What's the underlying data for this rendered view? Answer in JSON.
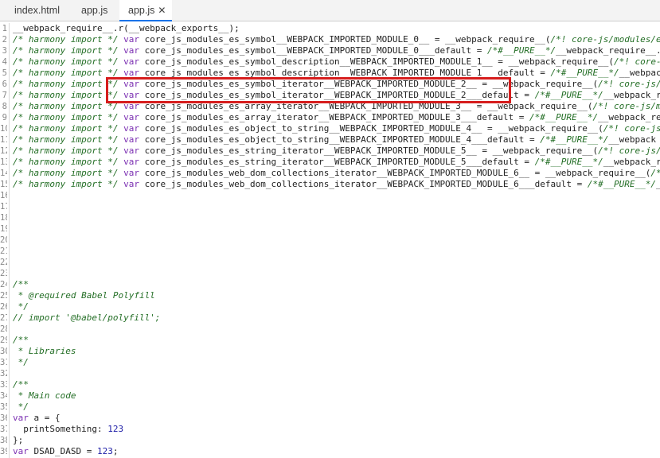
{
  "tabs": [
    {
      "label": "index.html",
      "active": false
    },
    {
      "label": "app.js",
      "active": false
    },
    {
      "label": "app.js",
      "active": true,
      "close": "✕"
    }
  ],
  "colors": {
    "comment": "#236e25",
    "keyword": "#7b2fb2",
    "number": "#1c1ca6",
    "highlight": "#d61d1d",
    "active_tab": "#1a73e8"
  },
  "lines": [
    {
      "num": "1",
      "tokens": [
        [
          "p",
          "__webpack_require__.r(__webpack_exports__);"
        ]
      ]
    },
    {
      "num": "2",
      "tokens": [
        [
          "c",
          "/* harmony import */ "
        ],
        [
          "k",
          "var"
        ],
        [
          "p",
          " core_js_modules_es_symbol__WEBPACK_IMPORTED_MODULE_0__ = __webpack_require__("
        ],
        [
          "c",
          "/*! core-js/modules/e"
        ]
      ]
    },
    {
      "num": "3",
      "tokens": [
        [
          "c",
          "/* harmony import */ "
        ],
        [
          "k",
          "var"
        ],
        [
          "p",
          " core_js_modules_es_symbol__WEBPACK_IMPORTED_MODULE_0___default = "
        ],
        [
          "c",
          "/*#__PURE__*/"
        ],
        [
          "p",
          "__webpack_require__."
        ]
      ]
    },
    {
      "num": "4",
      "tokens": [
        [
          "c",
          "/* harmony import */ "
        ],
        [
          "k",
          "var"
        ],
        [
          "p",
          " core_js_modules_es_symbol_description__WEBPACK_IMPORTED_MODULE_1__ = __webpack_require__("
        ],
        [
          "c",
          "/*! core-"
        ]
      ]
    },
    {
      "num": "5",
      "tokens": [
        [
          "c",
          "/* harmony import */ "
        ],
        [
          "k",
          "var"
        ],
        [
          "p",
          " core_js_modules_es_symbol_description__WEBPACK_IMPORTED_MODULE_1___default = "
        ],
        [
          "c",
          "/*#__PURE__*/"
        ],
        [
          "p",
          "__webpac"
        ]
      ]
    },
    {
      "num": "6",
      "tokens": [
        [
          "c",
          "/* harmony import */ "
        ],
        [
          "k",
          "var"
        ],
        [
          "p",
          " core_js_modules_es_symbol_iterator__WEBPACK_IMPORTED_MODULE_2__ = __webpack_require__("
        ],
        [
          "c",
          "/*! core-js/"
        ]
      ]
    },
    {
      "num": "7",
      "tokens": [
        [
          "c",
          "/* harmony import */ "
        ],
        [
          "k",
          "var"
        ],
        [
          "p",
          " core_js_modules_es_symbol_iterator__WEBPACK_IMPORTED_MODULE_2___default = "
        ],
        [
          "c",
          "/*#__PURE__*/"
        ],
        [
          "p",
          "__webpack_r"
        ]
      ]
    },
    {
      "num": "8",
      "tokens": [
        [
          "c",
          "/* harmony import */ "
        ],
        [
          "k",
          "var"
        ],
        [
          "p",
          " core_js_modules_es_array_iterator__WEBPACK_IMPORTED_MODULE_3__ = __webpack_require__("
        ],
        [
          "c",
          "/*! core-js/m"
        ]
      ]
    },
    {
      "num": "9",
      "tokens": [
        [
          "c",
          "/* harmony import */ "
        ],
        [
          "k",
          "var"
        ],
        [
          "p",
          " core_js_modules_es_array_iterator__WEBPACK_IMPORTED_MODULE_3___default = "
        ],
        [
          "c",
          "/*#__PURE__*/"
        ],
        [
          "p",
          "__webpack_re"
        ]
      ]
    },
    {
      "num": "10",
      "tokens": [
        [
          "c",
          "/* harmony import */ "
        ],
        [
          "k",
          "var"
        ],
        [
          "p",
          " core_js_modules_es_object_to_string__WEBPACK_IMPORTED_MODULE_4__ = __webpack_require__("
        ],
        [
          "c",
          "/*! core-js"
        ]
      ]
    },
    {
      "num": "11",
      "tokens": [
        [
          "c",
          "/* harmony import */ "
        ],
        [
          "k",
          "var"
        ],
        [
          "p",
          " core_js_modules_es_object_to_string__WEBPACK_IMPORTED_MODULE_4___default = "
        ],
        [
          "c",
          "/*#__PURE__*/"
        ],
        [
          "p",
          "__webpack"
        ]
      ]
    },
    {
      "num": "12",
      "tokens": [
        [
          "c",
          "/* harmony import */ "
        ],
        [
          "k",
          "var"
        ],
        [
          "p",
          " core_js_modules_es_string_iterator__WEBPACK_IMPORTED_MODULE_5__ = __webpack_require__("
        ],
        [
          "c",
          "/*! core-js/"
        ]
      ]
    },
    {
      "num": "13",
      "tokens": [
        [
          "c",
          "/* harmony import */ "
        ],
        [
          "k",
          "var"
        ],
        [
          "p",
          " core_js_modules_es_string_iterator__WEBPACK_IMPORTED_MODULE_5___default = "
        ],
        [
          "c",
          "/*#__PURE__*/"
        ],
        [
          "p",
          "__webpack_r"
        ]
      ]
    },
    {
      "num": "14",
      "tokens": [
        [
          "c",
          "/* harmony import */ "
        ],
        [
          "k",
          "var"
        ],
        [
          "p",
          " core_js_modules_web_dom_collections_iterator__WEBPACK_IMPORTED_MODULE_6__ = __webpack_require__("
        ],
        [
          "c",
          "/*"
        ]
      ]
    },
    {
      "num": "15",
      "tokens": [
        [
          "c",
          "/* harmony import */ "
        ],
        [
          "k",
          "var"
        ],
        [
          "p",
          " core_js_modules_web_dom_collections_iterator__WEBPACK_IMPORTED_MODULE_6___default = "
        ],
        [
          "c",
          "/*#__PURE__*/"
        ],
        [
          "p",
          "__"
        ]
      ]
    },
    {
      "num": "16",
      "tokens": []
    },
    {
      "num": "17",
      "tokens": []
    },
    {
      "num": "18",
      "tokens": []
    },
    {
      "num": "19",
      "tokens": []
    },
    {
      "num": "20",
      "tokens": []
    },
    {
      "num": "21",
      "tokens": []
    },
    {
      "num": "22",
      "tokens": []
    },
    {
      "num": "23",
      "tokens": []
    },
    {
      "num": "24",
      "tokens": [
        [
          "c",
          "/**"
        ]
      ]
    },
    {
      "num": "25",
      "tokens": [
        [
          "c",
          " * @required Babel Polyfill"
        ]
      ]
    },
    {
      "num": "26",
      "tokens": [
        [
          "c",
          " */"
        ]
      ]
    },
    {
      "num": "27",
      "tokens": [
        [
          "c",
          "// import '@babel/polyfill';"
        ]
      ]
    },
    {
      "num": "28",
      "tokens": []
    },
    {
      "num": "29",
      "tokens": [
        [
          "c",
          "/**"
        ]
      ]
    },
    {
      "num": "30",
      "tokens": [
        [
          "c",
          " * Libraries"
        ]
      ]
    },
    {
      "num": "31",
      "tokens": [
        [
          "c",
          " */"
        ]
      ]
    },
    {
      "num": "32",
      "tokens": []
    },
    {
      "num": "33",
      "tokens": [
        [
          "c",
          "/**"
        ]
      ]
    },
    {
      "num": "34",
      "tokens": [
        [
          "c",
          " * Main code"
        ]
      ]
    },
    {
      "num": "35",
      "tokens": [
        [
          "c",
          " */"
        ]
      ]
    },
    {
      "num": "36",
      "tokens": [
        [
          "k",
          "var"
        ],
        [
          "p",
          " a = {"
        ]
      ]
    },
    {
      "num": "37",
      "tokens": [
        [
          "p",
          "  printSomething: "
        ],
        [
          "n",
          "123"
        ]
      ]
    },
    {
      "num": "38",
      "tokens": [
        [
          "p",
          "};"
        ]
      ]
    },
    {
      "num": "39",
      "tokens": [
        [
          "k",
          "var"
        ],
        [
          "p",
          " DSAD_DASD = "
        ],
        [
          "n",
          "123"
        ],
        [
          "p",
          ";"
        ]
      ]
    }
  ]
}
